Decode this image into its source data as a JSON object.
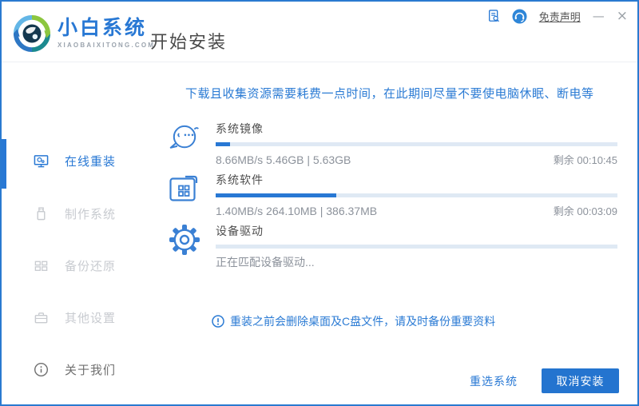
{
  "titlebar": {
    "disclaimer_label": "免责声明",
    "minimize_label": "—",
    "close_label": "×"
  },
  "brand": {
    "name": "小白系统",
    "domain": "XIAOBAIXITONG.COM"
  },
  "header": {
    "page_title": "开始安装"
  },
  "sidebar": {
    "items": [
      {
        "label": "在线重装",
        "icon": "monitor-icon",
        "active": true
      },
      {
        "label": "制作系统",
        "icon": "usb-icon",
        "active": false
      },
      {
        "label": "备份还原",
        "icon": "backup-grid-icon",
        "active": false
      },
      {
        "label": "其他设置",
        "icon": "toolbox-icon",
        "active": false
      },
      {
        "label": "关于我们",
        "icon": "info-icon",
        "active": false
      }
    ]
  },
  "main": {
    "headline": "下载且收集资源需要耗费一点时间，在此期间尽量不要使电脑休眠、断电等",
    "tasks": [
      {
        "name": "系统镜像",
        "icon": "chat-face-icon",
        "progress_percent": 3.5,
        "stats": "8.66MB/s 5.46GB | 5.63GB",
        "remaining": "剩余 00:10:45"
      },
      {
        "name": "系统软件",
        "icon": "folder-apps-icon",
        "progress_percent": 30,
        "stats": "1.40MB/s 264.10MB | 386.37MB",
        "remaining": "剩余 00:03:09"
      },
      {
        "name": "设备驱动",
        "icon": "gear-icon",
        "progress_percent": 0,
        "stats": "正在匹配设备驱动...",
        "remaining": ""
      }
    ],
    "notice": "重装之前会删除桌面及C盘文件，请及时备份重要资料"
  },
  "footer": {
    "reselect_label": "重选系统",
    "cancel_label": "取消安装"
  },
  "colors": {
    "accent": "#2878d4",
    "button": "#2474cf",
    "track": "#dfe9f4",
    "window_border": "#2a7ad0",
    "inactive_item": "#c8cbd0",
    "headline_blue": "#2b7bd4"
  }
}
